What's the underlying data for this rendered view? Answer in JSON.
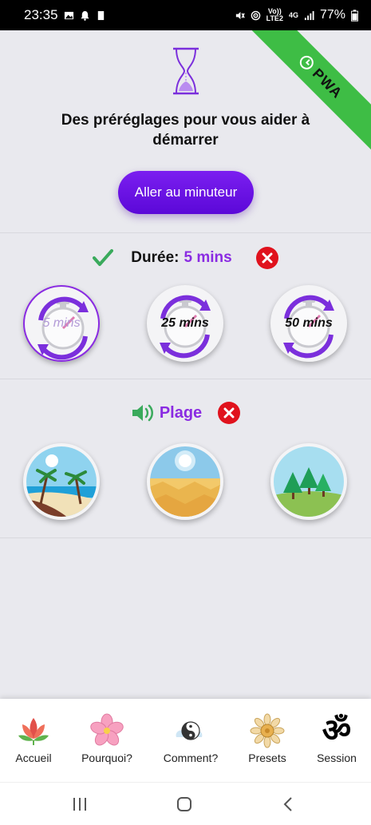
{
  "status_bar": {
    "time": "23:35",
    "network_type": "LTE2",
    "network_gen": "4G",
    "volte": "Vo))",
    "battery": "77%"
  },
  "ribbon": {
    "text": "PWA",
    "color": "#3ebd45"
  },
  "header": {
    "icon": "hourglass-icon",
    "title": "Des préréglages pour vous aider à démarrer",
    "timer_button": "Aller au minuteur"
  },
  "duration": {
    "label": "Durée:",
    "value": "5 mins",
    "options": [
      {
        "label": "5 mins",
        "selected": true
      },
      {
        "label": "25 mins",
        "selected": false
      },
      {
        "label": "50 mins",
        "selected": false
      }
    ]
  },
  "sound": {
    "label": "Plage",
    "options": [
      "beach",
      "desert",
      "forest"
    ]
  },
  "nav": {
    "items": [
      {
        "label": "Accueil",
        "icon": "lotus-icon"
      },
      {
        "label": "Pourquoi?",
        "icon": "flower-icon"
      },
      {
        "label": "Comment?",
        "icon": "yin-yang-icon"
      },
      {
        "label": "Presets",
        "icon": "mandala-icon"
      },
      {
        "label": "Session",
        "icon": "om-icon"
      }
    ]
  },
  "colors": {
    "accent": "#8a2be2",
    "button": "#6a10e6",
    "danger": "#e0121d",
    "check": "#3aaa5c"
  }
}
